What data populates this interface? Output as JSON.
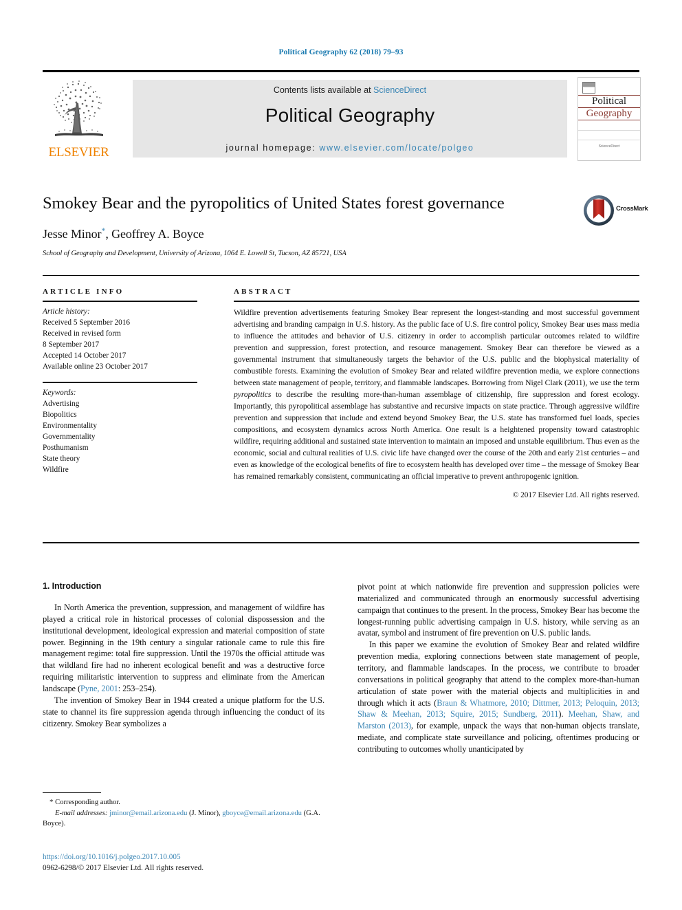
{
  "running_head": "Political Geography 62 (2018) 79–93",
  "masthead": {
    "contents_prefix": "Contents lists available at ",
    "sciencedirect_label": "ScienceDirect",
    "journal_title": "Political Geography",
    "homepage_prefix": "journal homepage: ",
    "homepage_url": "www.elsevier.com/locate/polgeo",
    "publisher_name": "ELSEVIER",
    "publisher_logo": "elsevier-tree-logo"
  },
  "cover": {
    "line1": "Political",
    "line2": "Geography",
    "footer": "ScienceDirect"
  },
  "article": {
    "title": "Smokey Bear and the pyropolitics of United States forest governance",
    "authors": "Jesse Minor, Geoffrey A. Boyce",
    "author_marker": "*",
    "affiliation": "School of Geography and Development, University of Arizona, 1064 E. Lowell St, Tucson, AZ 85721, USA",
    "crossmark_label": "CrossMark"
  },
  "article_info": {
    "heading": "ARTICLE INFO",
    "history_label": "Article history:",
    "history": [
      "Received 5 September 2016",
      "Received in revised form",
      "8 September 2017",
      "Accepted 14 October 2017",
      "Available online 23 October 2017"
    ],
    "keywords_label": "Keywords:",
    "keywords": [
      "Advertising",
      "Biopolitics",
      "Environmentality",
      "Governmentality",
      "Posthumanism",
      "State theory",
      "Wildfire"
    ]
  },
  "abstract": {
    "heading": "ABSTRACT",
    "paragraph_part1": "Wildfire prevention advertisements featuring Smokey Bear represent the longest-standing and most successful government advertising and branding campaign in U.S. history. As the public face of U.S. fire control policy, Smokey Bear uses mass media to influence the attitudes and behavior of U.S. citizenry in order to accomplish particular outcomes related to wildfire prevention and suppression, forest protection, and resource management. Smokey Bear can therefore be viewed as a governmental instrument that simultaneously targets the behavior of the U.S. public and the biophysical materiality of combustible forests. Examining the evolution of Smokey Bear and related wildfire prevention media, we explore connections between state management of people, territory, and flammable landscapes. Borrowing from Nigel Clark (2011), we use the term ",
    "italic_term": "pyropolitics",
    "paragraph_part2": " to describe the resulting more-than-human assemblage of citizenship, fire suppression and forest ecology. Importantly, this pyropolitical assemblage has substantive and recursive impacts on state practice. Through aggressive wildfire prevention and suppression that include and extend beyond Smokey Bear, the U.S. state has transformed fuel loads, species compositions, and ecosystem dynamics across North America. One result is a heightened propensity toward catastrophic wildfire, requiring additional and sustained state intervention to maintain an imposed and unstable equilibrium. Thus even as the economic, social and cultural realities of U.S. civic life have changed over the course of the 20th and early 21st centuries – and even as knowledge of the ecological benefits of fire to ecosystem health has developed over time – the message of Smokey Bear has remained remarkably consistent, communicating an official imperative to prevent anthropogenic ignition.",
    "copyright": "© 2017 Elsevier Ltd. All rights reserved."
  },
  "introduction": {
    "section_number_title": "1. Introduction",
    "p1_part1": "In North America the prevention, suppression, and management of wildfire has played a critical role in historical processes of colonial dispossession and the institutional development, ideological expression and material composition of state power. Beginning in the 19th century a singular rationale came to rule this fire management regime: total fire suppression. Until the 1970s the official attitude was that wildland fire had no inherent ecological benefit and was a destructive force requiring militaristic intervention to suppress and eliminate from the American landscape (",
    "p1_citation": "Pyne, 2001",
    "p1_part2": ": 253–254).",
    "p2": "The invention of Smokey Bear in 1944 created a unique platform for the U.S. state to channel its fire suppression agenda through influencing the conduct of its citizenry. Smokey Bear symbolizes a",
    "p3": "pivot point at which nationwide fire prevention and suppression policies were materialized and communicated through an enormously successful advertising campaign that continues to the present. In the process, Smokey Bear has become the longest-running public advertising campaign in U.S. history, while serving as an avatar, symbol and instrument of fire prevention on U.S. public lands.",
    "p4_part1": "In this paper we examine the evolution of Smokey Bear and related wildfire prevention media, exploring connections between state management of people, territory, and flammable landscapes. In the process, we contribute to broader conversations in political geography that attend to the complex more-than-human articulation of state power with the material objects and multiplicities in and through which it acts (",
    "p4_citation1": "Braun & Whatmore, 2010; Dittmer, 2013; Peloquin, 2013; Shaw & Meehan, 2013; Squire, 2015; Sundberg, 2011",
    "p4_part2": "). ",
    "p4_citation2": "Meehan, Shaw, and Marston (2013)",
    "p4_part3": ", for example, unpack the ways that non-human objects translate, mediate, and complicate state surveillance and policing, oftentimes producing or contributing to outcomes wholly unanticipated by"
  },
  "footnote": {
    "corresponding": "Corresponding author.",
    "email_label": "E-mail addresses:",
    "email1": "jminor@email.arizona.edu",
    "email1_owner": " (J. Minor), ",
    "email2": "gboyce@email.arizona.edu",
    "email2_owner": " (G.A. Boyce)."
  },
  "footer": {
    "doi": "https://doi.org/10.1016/j.polgeo.2017.10.005",
    "issn_line": "0962-6298/© 2017 Elsevier Ltd. All rights reserved."
  },
  "colors": {
    "link_blue": "#3b86b5",
    "running_head_blue": "#1a7ab0",
    "elsevier_orange": "#ef8200",
    "cover_maroon": "#8a3b33",
    "band_gray": "#e6e6e6"
  }
}
